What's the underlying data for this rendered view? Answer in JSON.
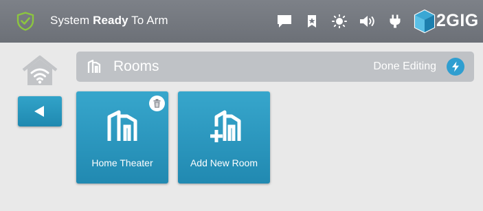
{
  "status": {
    "text_prefix": "System ",
    "text_bold": "Ready",
    "text_suffix": " To Arm",
    "shield_color": "#8cc63f"
  },
  "tray": {
    "icons": [
      "message-icon",
      "bookmark-icon",
      "brightness-icon",
      "volume-icon",
      "power-plug-icon"
    ]
  },
  "brand": {
    "name": "2GIG",
    "accent": "#3aa7d4"
  },
  "header": {
    "title": "Rooms",
    "done_label": "Done Editing"
  },
  "rooms": [
    {
      "label": "Home Theater",
      "icon": "room-icon",
      "deletable": true
    },
    {
      "label": "Add New Room",
      "icon": "add-room-icon",
      "deletable": false
    }
  ],
  "colors": {
    "topbar": "#757980",
    "tile": "#2b97bf",
    "header_bar": "#bfc2c6",
    "background": "#e9e9e9"
  }
}
